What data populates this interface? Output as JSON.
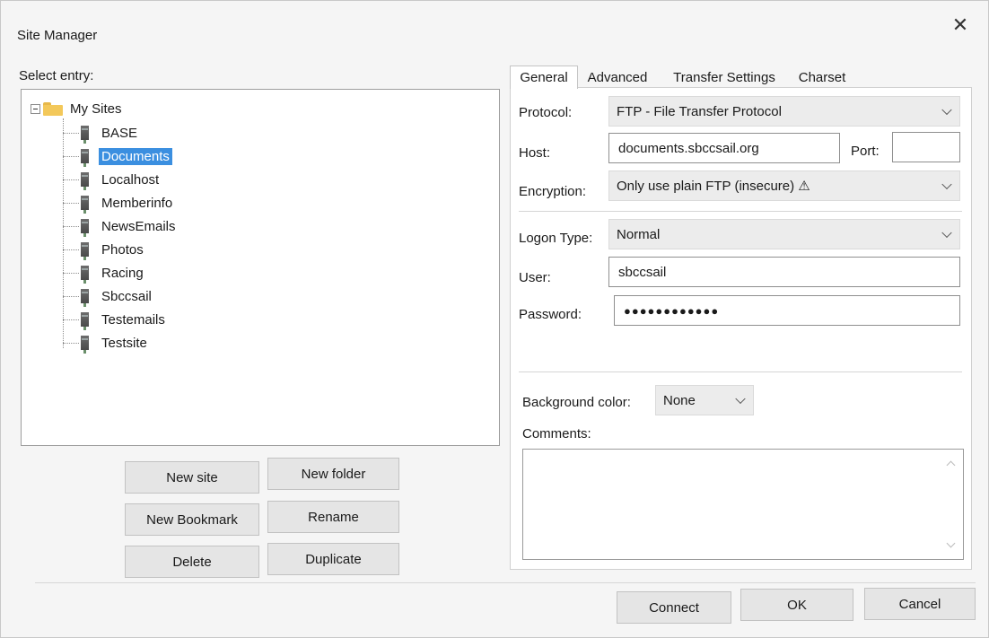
{
  "window": {
    "title": "Site Manager",
    "close_glyph": "✕"
  },
  "tree": {
    "select_label": "Select entry:",
    "root": {
      "label": "My Sites",
      "icon": "folder-icon"
    },
    "items": [
      {
        "label": "BASE"
      },
      {
        "label": "Documents",
        "selected": true
      },
      {
        "label": "Localhost"
      },
      {
        "label": "Memberinfo"
      },
      {
        "label": "NewsEmails"
      },
      {
        "label": "Photos"
      },
      {
        "label": "Racing"
      },
      {
        "label": "Sbccsail"
      },
      {
        "label": "Testemails"
      },
      {
        "label": "Testsite"
      }
    ]
  },
  "buttons": {
    "new_site": "New site",
    "new_folder": "New folder",
    "new_bookmark": "New Bookmark",
    "rename": "Rename",
    "delete": "Delete",
    "duplicate": "Duplicate",
    "connect": "Connect",
    "ok": "OK",
    "cancel": "Cancel"
  },
  "tabs": [
    {
      "label": "General",
      "active": true
    },
    {
      "label": "Advanced"
    },
    {
      "label": "Transfer Settings"
    },
    {
      "label": "Charset"
    }
  ],
  "general": {
    "protocol_label": "Protocol:",
    "protocol_value": "FTP - File Transfer Protocol",
    "host_label": "Host:",
    "host_value": "documents.sbccsail.org",
    "port_label": "Port:",
    "port_value": "",
    "encryption_label": "Encryption:",
    "encryption_value": "Only use plain FTP (insecure) ⚠",
    "logon_label": "Logon Type:",
    "logon_value": "Normal",
    "user_label": "User:",
    "user_value": "sbccsail",
    "password_label": "Password:",
    "password_value": "●●●●●●●●●●●●",
    "bg_color_label": "Background color:",
    "bg_color_value": "None",
    "comments_label": "Comments:",
    "comments_value": ""
  },
  "colors": {
    "selection": "#3b8fe0",
    "folder": "#f3c85a"
  }
}
